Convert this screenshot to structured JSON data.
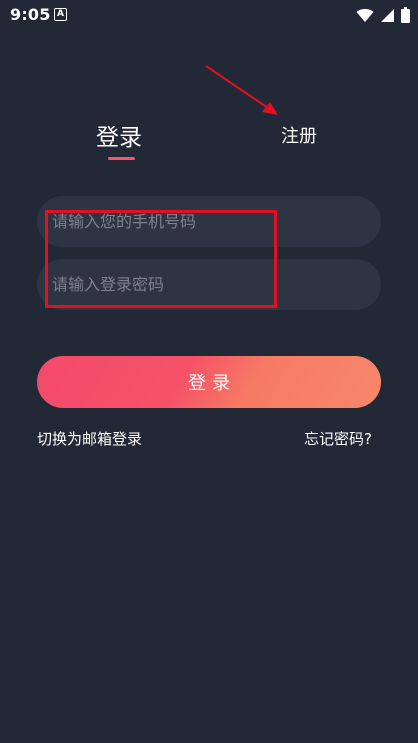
{
  "status_bar": {
    "time": "9:05",
    "notification_icon": "A"
  },
  "tabs": {
    "login_label": "登录",
    "register_label": "注册"
  },
  "form": {
    "phone_placeholder": "请输入您的手机号码",
    "password_placeholder": "请输入登录密码",
    "login_button_label": "登录"
  },
  "links": {
    "switch_email_label": "切换为邮箱登录",
    "forgot_password_label": "忘记密码?"
  },
  "colors": {
    "background": "#232836",
    "input_background": "#2e3444",
    "accent": "#f2566c",
    "button_gradient_start": "#f4496c",
    "button_gradient_end": "#f7886a",
    "annotation_red": "#e3101f"
  },
  "icons": [
    "a-notification-icon",
    "wifi-icon",
    "cellular-signal-icon",
    "battery-icon",
    "annotation-arrow"
  ]
}
